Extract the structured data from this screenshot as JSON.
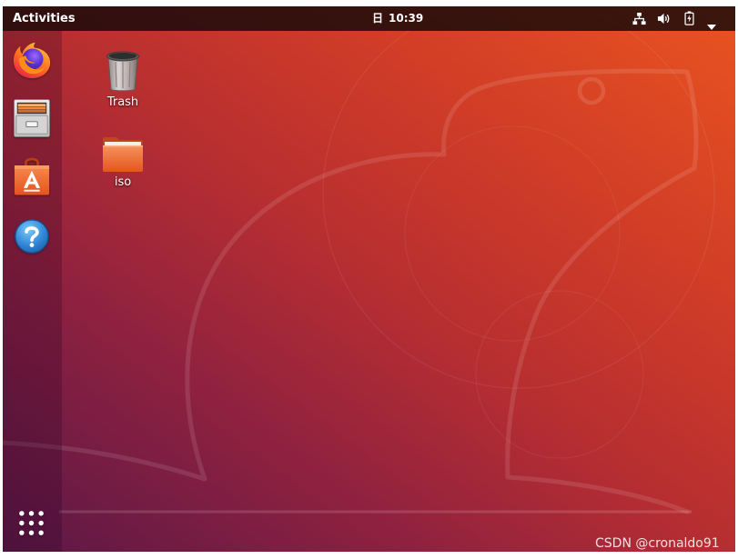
{
  "topbar": {
    "activities_label": "Activities",
    "clock": {
      "weekday": "日",
      "time": "10:39"
    },
    "status_icons": {
      "network": "network-wired-icon",
      "volume": "volume-icon",
      "battery": "battery-charging-icon",
      "menu": "dropdown-arrow-icon"
    }
  },
  "dock": {
    "apps": [
      {
        "icon": "firefox-icon"
      },
      {
        "icon": "files-icon"
      },
      {
        "icon": "ubuntu-software-icon"
      },
      {
        "icon": "help-icon"
      }
    ],
    "show_applications_icon": "show-applications-icon"
  },
  "desktop": {
    "items": [
      {
        "label": "Trash",
        "icon": "trash-icon"
      },
      {
        "label": "iso",
        "icon": "folder-icon"
      }
    ]
  },
  "watermark": "CSDN @cronaldo91",
  "colors": {
    "accent": "#E95420",
    "wallpaper_purple": "#5B1846",
    "wallpaper_red": "#B72E31",
    "label_text": "#FFFFFF"
  }
}
